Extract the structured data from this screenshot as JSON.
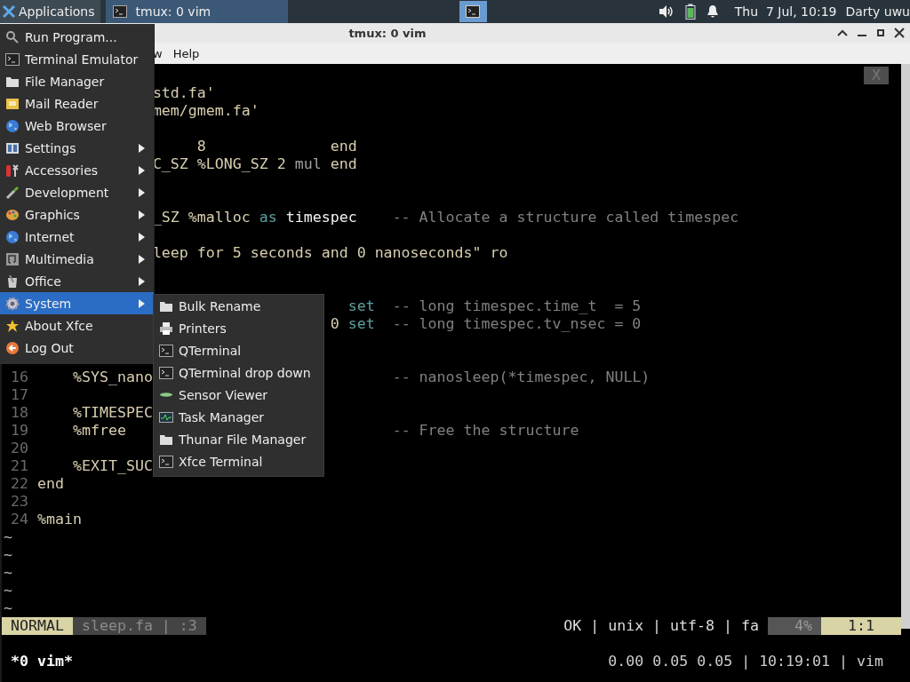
{
  "panel": {
    "applications_label": "Applications",
    "task_label": "tmux: 0 vim",
    "clock": "Thu  7 Jul, 10:19",
    "user": "Darty uwu"
  },
  "window": {
    "title": "tmux: 0 vim"
  },
  "menubar": [
    "w",
    "Help"
  ],
  "editor": {
    "close_label": "X",
    "lines": [
      {
        "kind": "blank"
      },
      {
        "kind": "code",
        "segments": [
          {
            "kind": "code",
            "text": "             std.fa'"
          }
        ]
      },
      {
        "kind": "code",
        "segments": [
          {
            "kind": "code",
            "text": "             mem/gmem.fa'"
          }
        ]
      },
      {
        "kind": "blank"
      },
      {
        "kind": "code",
        "segments": [
          {
            "kind": "code",
            "text": "                  8              end"
          }
        ]
      },
      {
        "kind": "code",
        "segments": [
          {
            "kind": "code",
            "text": "             C_SZ %LONG_SZ 2 "
          },
          {
            "kind": "operator",
            "text": "mul"
          },
          {
            "kind": "code",
            "text": " end"
          }
        ]
      },
      {
        "kind": "blank"
      },
      {
        "kind": "blank"
      },
      {
        "kind": "code",
        "segments": [
          {
            "kind": "code",
            "text": "             _SZ %malloc "
          },
          {
            "kind": "keyword",
            "text": "as"
          },
          {
            "kind": "ident",
            "text": " timespec"
          },
          {
            "kind": "comment",
            "text": "    -- Allocate a structure called timespec"
          }
        ]
      },
      {
        "kind": "blank"
      },
      {
        "kind": "code",
        "segments": [
          {
            "kind": "code",
            "text": "             leep for 5 seconds and 0 nanoseconds\" ro"
          }
        ]
      },
      {
        "kind": "blank"
      },
      {
        "kind": "blank"
      },
      {
        "kind": "code",
        "segments": [
          {
            "kind": "keyword",
            "text": "                                   set"
          },
          {
            "kind": "comment",
            "text": "  -- long timespec.time_t  = 5"
          }
        ]
      },
      {
        "kind": "code",
        "segments": [
          {
            "kind": "code",
            "text": "                                 0 "
          },
          {
            "kind": "keyword",
            "text": "set"
          },
          {
            "kind": "comment",
            "text": "  -- long timespec.tv_nsec = 0"
          }
        ]
      },
      {
        "kind": "blank"
      },
      {
        "kind": "blank"
      },
      {
        "kind": "code",
        "number": "16",
        "segments": [
          {
            "kind": "code",
            "text": "    %SYS_nano"
          }
        ],
        "trailing_comment": "                           -- nanosleep(*timespec, NULL)"
      },
      {
        "kind": "code",
        "number": "17"
      },
      {
        "kind": "code",
        "number": "18",
        "segments": [
          {
            "kind": "code",
            "text": "    %TIMESPEC"
          }
        ]
      },
      {
        "kind": "code",
        "number": "19",
        "segments": [
          {
            "kind": "code",
            "text": "    %mfree"
          }
        ],
        "trailing_comment": "                              -- Free the structure"
      },
      {
        "kind": "code",
        "number": "20"
      },
      {
        "kind": "code",
        "number": "21",
        "segments": [
          {
            "kind": "code",
            "text": "    %EXIT_SUC"
          }
        ]
      },
      {
        "kind": "code",
        "number": "22",
        "segments": [
          {
            "kind": "code",
            "text": "end"
          }
        ]
      },
      {
        "kind": "code",
        "number": "23"
      },
      {
        "kind": "code",
        "number": "24",
        "segments": [
          {
            "kind": "code",
            "text": "%main"
          }
        ]
      },
      {
        "kind": "tilde",
        "text": "~"
      },
      {
        "kind": "tilde",
        "text": "~"
      },
      {
        "kind": "tilde",
        "text": "~"
      },
      {
        "kind": "tilde",
        "text": "~"
      },
      {
        "kind": "tilde",
        "text": "~"
      }
    ]
  },
  "statusline": {
    "mode": "NORMAL",
    "file": "sleep.fa | :3",
    "info": "OK | unix | utf-8 | fa",
    "percent": "4%",
    "position": "1:1"
  },
  "tmux": {
    "window": "*0 vim*",
    "status": "0.00 0.05 0.05 | 10:19:01 | vim"
  },
  "app_menu": {
    "items": [
      {
        "label": "Run Program...",
        "has_submenu": false,
        "selected": false
      },
      {
        "label": "Terminal Emulator",
        "has_submenu": false,
        "selected": false
      },
      {
        "label": "File Manager",
        "has_submenu": false,
        "selected": false
      },
      {
        "label": "Mail Reader",
        "has_submenu": false,
        "selected": false
      },
      {
        "label": "Web Browser",
        "has_submenu": false,
        "selected": false
      },
      {
        "label": "Settings",
        "has_submenu": true,
        "selected": false
      },
      {
        "label": "Accessories",
        "has_submenu": true,
        "selected": false
      },
      {
        "label": "Development",
        "has_submenu": true,
        "selected": false
      },
      {
        "label": "Graphics",
        "has_submenu": true,
        "selected": false
      },
      {
        "label": "Internet",
        "has_submenu": true,
        "selected": false
      },
      {
        "label": "Multimedia",
        "has_submenu": true,
        "selected": false
      },
      {
        "label": "Office",
        "has_submenu": true,
        "selected": false
      },
      {
        "label": "System",
        "has_submenu": true,
        "selected": true
      },
      {
        "label": "About Xfce",
        "has_submenu": false,
        "selected": false
      },
      {
        "label": "Log Out",
        "has_submenu": false,
        "selected": false
      }
    ]
  },
  "system_submenu": {
    "items": [
      {
        "label": "Bulk Rename"
      },
      {
        "label": "Printers"
      },
      {
        "label": "QTerminal"
      },
      {
        "label": "QTerminal drop down"
      },
      {
        "label": "Sensor Viewer"
      },
      {
        "label": "Task Manager"
      },
      {
        "label": "Thunar File Manager"
      },
      {
        "label": "Xfce Terminal"
      }
    ]
  }
}
